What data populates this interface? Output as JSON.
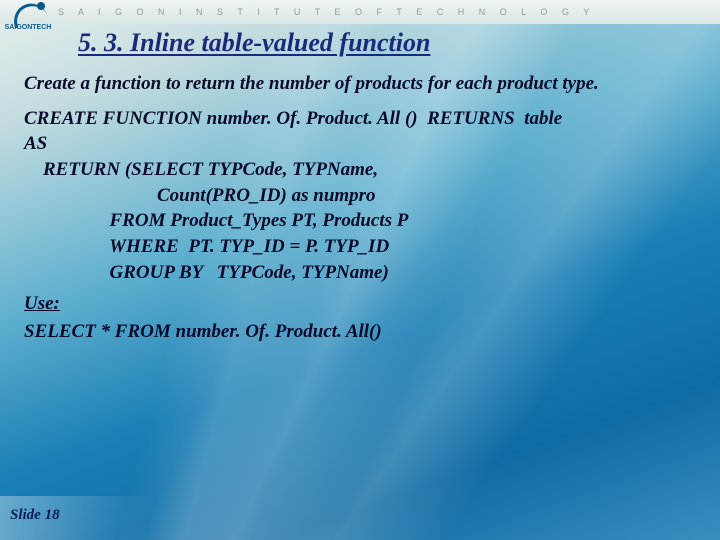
{
  "header": {
    "institute": "S A I G O N   I N S T I T U T E   O F   T E C H N O L O G Y",
    "logo_label": "SAIGONTECH"
  },
  "title": "5. 3. Inline table-valued function",
  "intro": "Create a function to return the number of products for each product type.",
  "code": "CREATE FUNCTION number. Of. Product. All ()  RETURNS  table\nAS\n    RETURN (SELECT TYPCode, TYPName,\n                            Count(PRO_ID) as numpro\n                  FROM Product_Types PT, Products P\n                  WHERE  PT. TYP_ID = P. TYP_ID\n                  GROUP BY   TYPCode, TYPName)",
  "use_label": "Use:",
  "use_query": "SELECT  * FROM number. Of. Product. All()",
  "footer": "Slide 18"
}
